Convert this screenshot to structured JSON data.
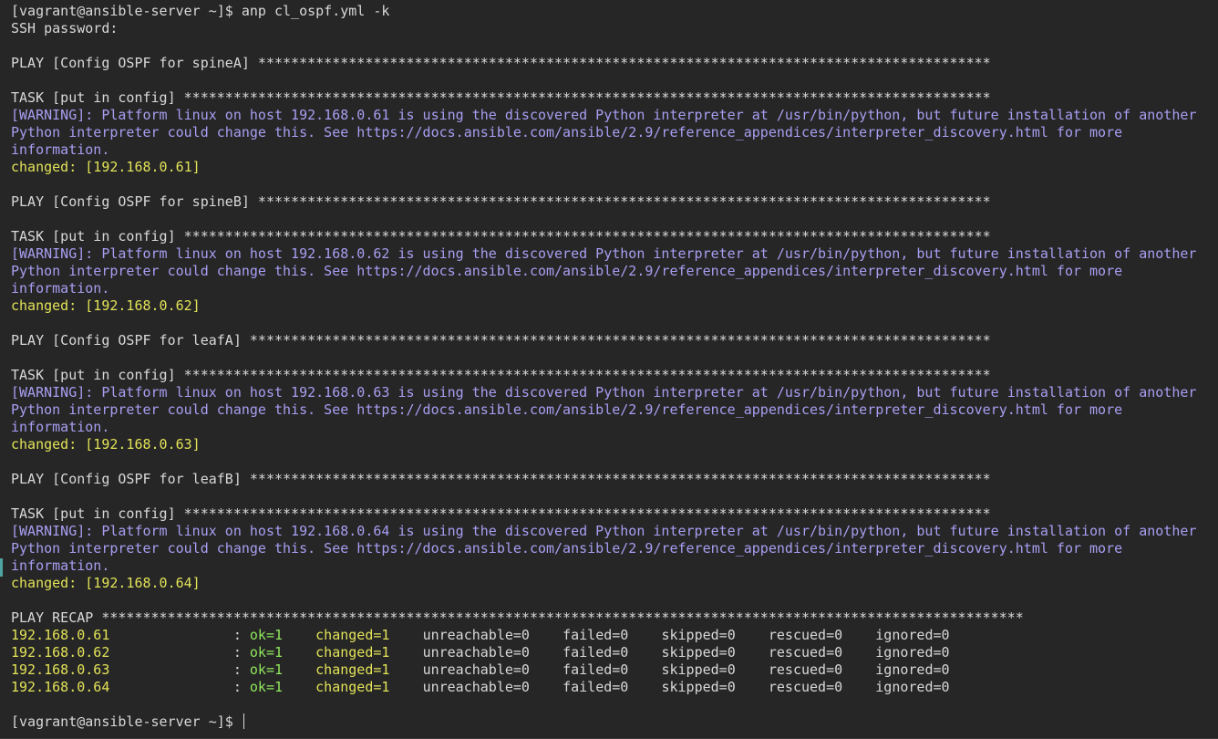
{
  "terminal": {
    "lines": [
      {
        "t": "[vagrant@ansible-server ~]$ anp cl_ospf.yml -k"
      },
      {
        "t": "SSH password:"
      },
      {
        "t": ""
      },
      {
        "t": "PLAY [Config OSPF for spineA] *****************************************************************************************"
      },
      {
        "t": ""
      },
      {
        "t": "TASK [put in config] **************************************************************************************************"
      },
      {
        "t": "[WARNING]: Platform linux on host 192.168.0.61 is using the discovered Python interpreter at /usr/bin/python, but future installation of another",
        "c": "w"
      },
      {
        "t": "Python interpreter could change this. See https://docs.ansible.com/ansible/2.9/reference_appendices/interpreter_discovery.html for more",
        "c": "w"
      },
      {
        "t": "information.",
        "c": "w"
      },
      {
        "t": "changed: [192.168.0.61]",
        "c": "y"
      },
      {
        "t": ""
      },
      {
        "t": "PLAY [Config OSPF for spineB] *****************************************************************************************"
      },
      {
        "t": ""
      },
      {
        "t": "TASK [put in config] **************************************************************************************************"
      },
      {
        "t": "[WARNING]: Platform linux on host 192.168.0.62 is using the discovered Python interpreter at /usr/bin/python, but future installation of another",
        "c": "w"
      },
      {
        "t": "Python interpreter could change this. See https://docs.ansible.com/ansible/2.9/reference_appendices/interpreter_discovery.html for more",
        "c": "w"
      },
      {
        "t": "information.",
        "c": "w"
      },
      {
        "t": "changed: [192.168.0.62]",
        "c": "y"
      },
      {
        "t": ""
      },
      {
        "t": "PLAY [Config OSPF for leafA] ******************************************************************************************"
      },
      {
        "t": ""
      },
      {
        "t": "TASK [put in config] **************************************************************************************************"
      },
      {
        "t": "[WARNING]: Platform linux on host 192.168.0.63 is using the discovered Python interpreter at /usr/bin/python, but future installation of another",
        "c": "w"
      },
      {
        "t": "Python interpreter could change this. See https://docs.ansible.com/ansible/2.9/reference_appendices/interpreter_discovery.html for more",
        "c": "w"
      },
      {
        "t": "information.",
        "c": "w"
      },
      {
        "t": "changed: [192.168.0.63]",
        "c": "y"
      },
      {
        "t": ""
      },
      {
        "t": "PLAY [Config OSPF for leafB] ******************************************************************************************"
      },
      {
        "t": ""
      },
      {
        "t": "TASK [put in config] **************************************************************************************************"
      },
      {
        "t": "[WARNING]: Platform linux on host 192.168.0.64 is using the discovered Python interpreter at /usr/bin/python, but future installation of another",
        "c": "w"
      },
      {
        "t": "Python interpreter could change this. See https://docs.ansible.com/ansible/2.9/reference_appendices/interpreter_discovery.html for more",
        "c": "w"
      },
      {
        "t": "information.",
        "c": "w"
      },
      {
        "t": "changed: [192.168.0.64]",
        "c": "y"
      },
      {
        "t": ""
      },
      {
        "t": "PLAY RECAP ****************************************************************************************************************"
      }
    ],
    "recap": [
      {
        "host": "192.168.0.61",
        "sep": ": ",
        "ok": "ok=1",
        "changed": "changed=1",
        "unreachable": "unreachable=0",
        "failed": "failed=0",
        "skipped": "skipped=0",
        "rescued": "rescued=0",
        "ignored": "ignored=0"
      },
      {
        "host": "192.168.0.62",
        "sep": ": ",
        "ok": "ok=1",
        "changed": "changed=1",
        "unreachable": "unreachable=0",
        "failed": "failed=0",
        "skipped": "skipped=0",
        "rescued": "rescued=0",
        "ignored": "ignored=0"
      },
      {
        "host": "192.168.0.63",
        "sep": ": ",
        "ok": "ok=1",
        "changed": "changed=1",
        "unreachable": "unreachable=0",
        "failed": "failed=0",
        "skipped": "skipped=0",
        "rescued": "rescued=0",
        "ignored": "ignored=0"
      },
      {
        "host": "192.168.0.64",
        "sep": ": ",
        "ok": "ok=1",
        "changed": "changed=1",
        "unreachable": "unreachable=0",
        "failed": "failed=0",
        "skipped": "skipped=0",
        "rescued": "rescued=0",
        "ignored": "ignored=0"
      }
    ],
    "prompt": "[vagrant@ansible-server ~]$ "
  },
  "colors": {
    "background": "#262626",
    "text": "#d8d8d8",
    "warning": "#a79ef1",
    "changed": "#e2e258",
    "ok": "#8fe65d"
  }
}
